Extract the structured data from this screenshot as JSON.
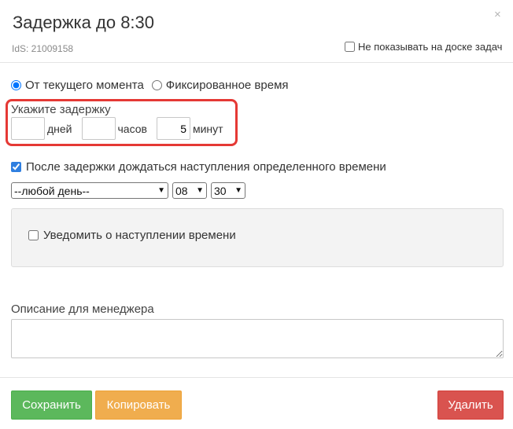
{
  "header": {
    "title": "Задержка до 8:30",
    "close_glyph": "×",
    "ids_text": "IdS: 21009158",
    "hide_board_label": "Не показывать на доске задач",
    "hide_board_checked": false
  },
  "mode": {
    "option1_label": "От текущего момента",
    "option2_label": "Фиксированное время",
    "selected": "option1"
  },
  "delay": {
    "label": "Укажите задержку",
    "days_value": "",
    "days_unit": "дней",
    "hours_value": "",
    "hours_unit": "часов",
    "minutes_value": "5",
    "minutes_unit": "минут"
  },
  "after_wait": {
    "label": "После задержки дождаться наступления определенного времени",
    "checked": true,
    "day_select": "--любой день--",
    "hour_select": "08",
    "minute_select": "30"
  },
  "notify": {
    "label": "Уведомить о наступлении времени",
    "checked": false
  },
  "description": {
    "label": "Описание для менеджера",
    "value": ""
  },
  "footer": {
    "save_label": "Сохранить",
    "copy_label": "Копировать",
    "delete_label": "Удалить"
  },
  "colors": {
    "save": "#5cb85c",
    "copy": "#f0ad4e",
    "delete": "#d9534f",
    "highlight_box": "#e53935",
    "accent": "#2f7fe0"
  }
}
